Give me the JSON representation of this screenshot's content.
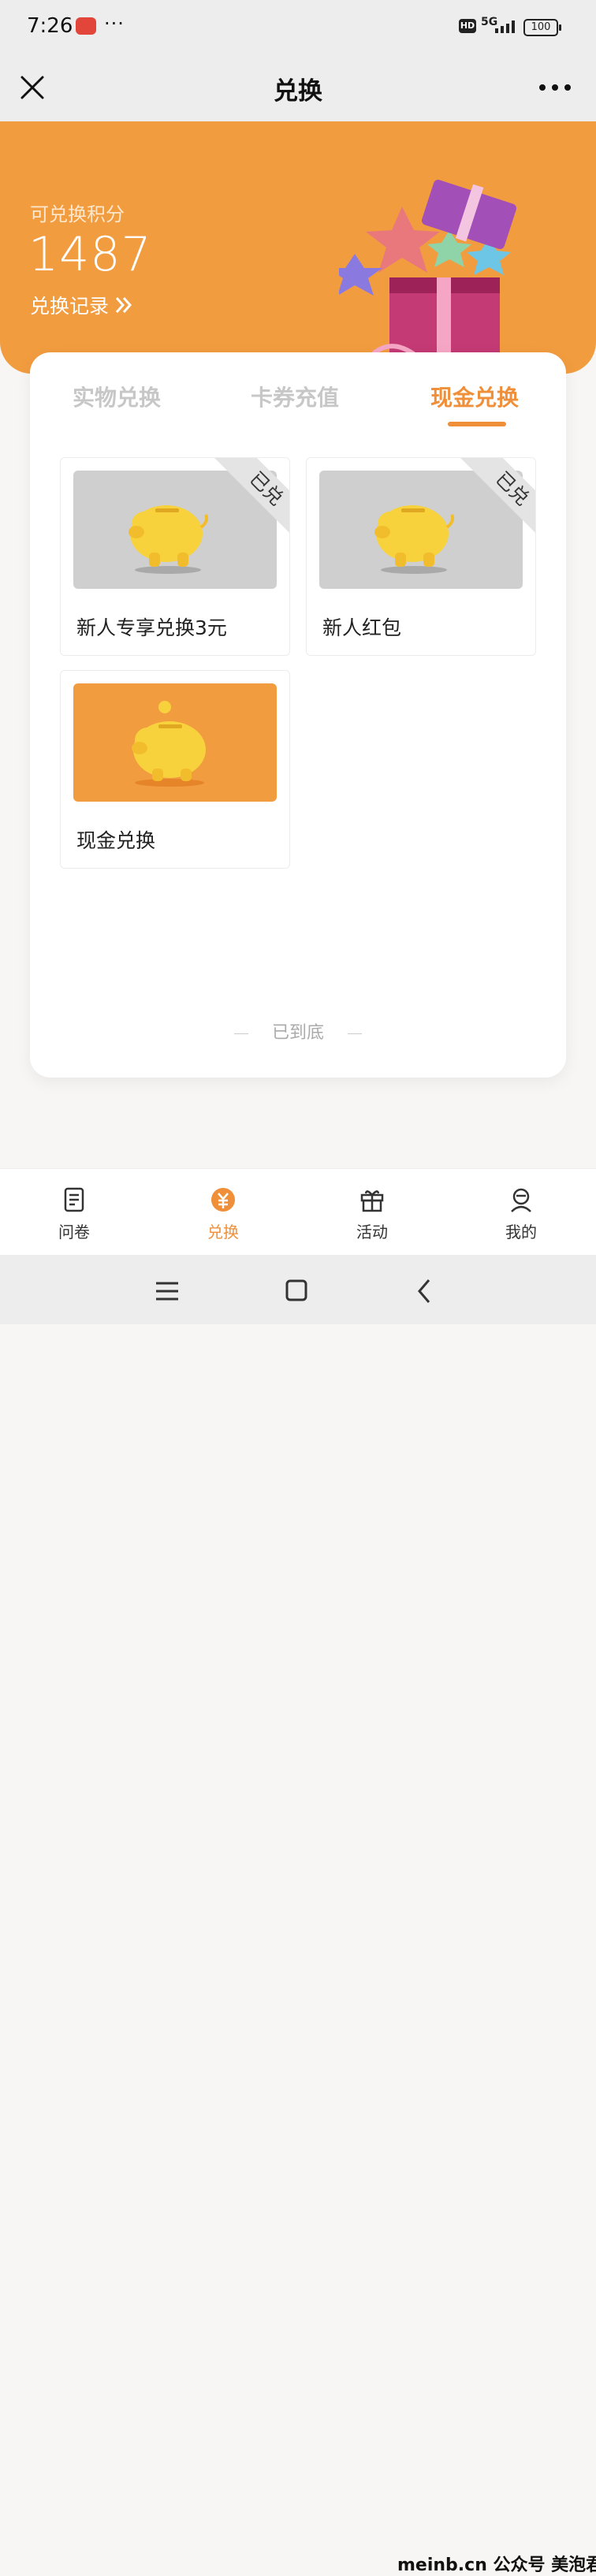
{
  "status_bar": {
    "time": "7:26",
    "more": "···",
    "hd": "HD",
    "network": "5G",
    "battery": "100"
  },
  "nav": {
    "title": "兑换"
  },
  "hero": {
    "label": "可兑换积分",
    "points": "1487",
    "record_label": "兑换记录"
  },
  "tabs": [
    {
      "label": "实物兑换",
      "active": false
    },
    {
      "label": "卡券充值",
      "active": false
    },
    {
      "label": "现金兑换",
      "active": true
    }
  ],
  "tiles": [
    {
      "name": "新人专享兑换3元",
      "ribbon": "已兑",
      "style": "gray"
    },
    {
      "name": "新人红包",
      "ribbon": "已兑",
      "style": "gray"
    },
    {
      "name": "现金兑换",
      "ribbon": "",
      "style": "orange"
    }
  ],
  "list_end": "已到底",
  "tabbar": [
    {
      "label": "问卷",
      "icon": "survey-icon"
    },
    {
      "label": "兑换",
      "icon": "exchange-icon",
      "active": true
    },
    {
      "label": "活动",
      "icon": "gift-icon"
    },
    {
      "label": "我的",
      "icon": "profile-icon"
    }
  ],
  "watermark": "meinb.cn  公众号 美泡君",
  "colors": {
    "accent": "#ef8f3a",
    "hero": "#f29c40"
  }
}
